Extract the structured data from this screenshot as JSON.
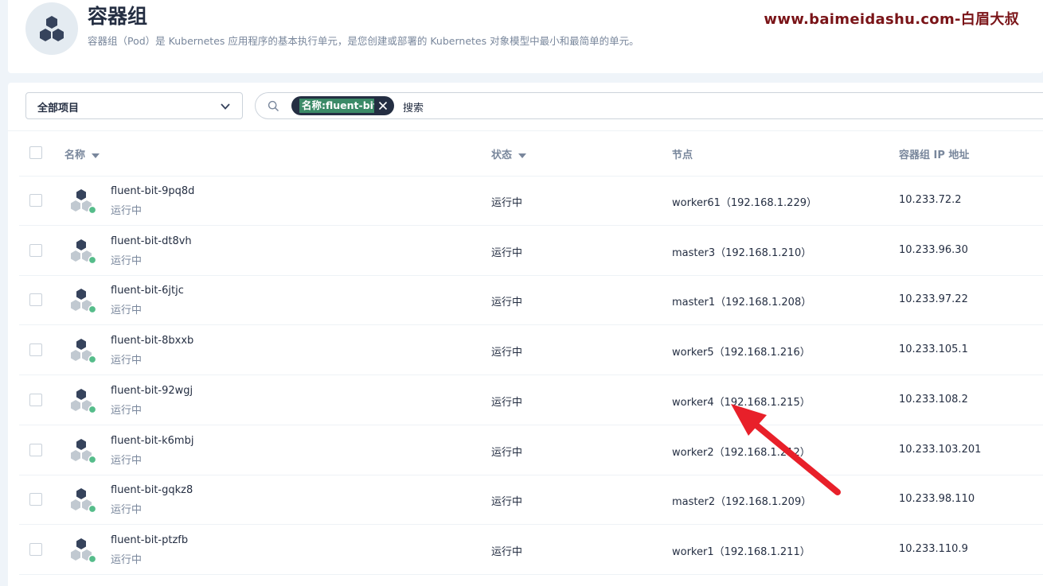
{
  "header": {
    "title": "容器组",
    "description": "容器组（Pod）是 Kubernetes 应用程序的基本执行单元，是您创建或部署的 Kubernetes 对象模型中最小和最简单的单元。",
    "watermark": "www.baimeidashu.com-白眉大叔",
    "icon": "pod-cluster-icon"
  },
  "toolbar": {
    "project_select": "全部项目",
    "filter_tag": "名称:fluent-bit",
    "search_placeholder": "搜索"
  },
  "table": {
    "columns": {
      "name": "名称",
      "status": "状态",
      "node": "节点",
      "ip": "容器组 IP 地址"
    },
    "rows": [
      {
        "name": "fluent-bit-9pq8d",
        "sub": "运行中",
        "status": "运行中",
        "node": "worker61（192.168.1.229）",
        "ip": "10.233.72.2"
      },
      {
        "name": "fluent-bit-dt8vh",
        "sub": "运行中",
        "status": "运行中",
        "node": "master3（192.168.1.210）",
        "ip": "10.233.96.30"
      },
      {
        "name": "fluent-bit-6jtjc",
        "sub": "运行中",
        "status": "运行中",
        "node": "master1（192.168.1.208）",
        "ip": "10.233.97.22"
      },
      {
        "name": "fluent-bit-8bxxb",
        "sub": "运行中",
        "status": "运行中",
        "node": "worker5（192.168.1.216）",
        "ip": "10.233.105.1"
      },
      {
        "name": "fluent-bit-92wgj",
        "sub": "运行中",
        "status": "运行中",
        "node": "worker4（192.168.1.215）",
        "ip": "10.233.108.2"
      },
      {
        "name": "fluent-bit-k6mbj",
        "sub": "运行中",
        "status": "运行中",
        "node": "worker2（192.168.1.212）",
        "ip": "10.233.103.201"
      },
      {
        "name": "fluent-bit-gqkz8",
        "sub": "运行中",
        "status": "运行中",
        "node": "master2（192.168.1.209）",
        "ip": "10.233.98.110"
      },
      {
        "name": "fluent-bit-ptzfb",
        "sub": "运行中",
        "status": "运行中",
        "node": "worker1（192.168.1.211）",
        "ip": "10.233.110.9"
      }
    ]
  },
  "colors": {
    "status_running": "#55bc8a",
    "annotation_arrow": "#e8202a",
    "watermark": "#7a1418"
  }
}
